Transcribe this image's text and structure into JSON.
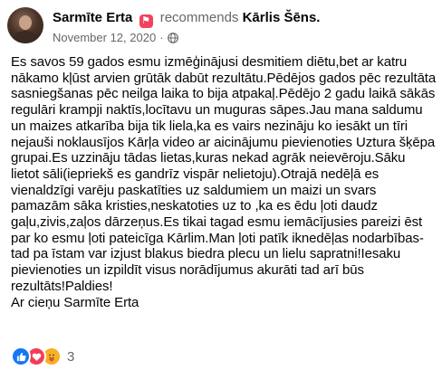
{
  "post": {
    "author": "Sarmīte Erta",
    "action": "recommends",
    "recommended_page": "Kārlis Šēns.",
    "date": "November 12, 2020",
    "separator": "·",
    "body": [
      "Es savos 59 gados esmu izmēģinājusi desmitiem diētu,bet ar katru nākamo kļūst arvien grūtāk dabūt rezultātu.Pēdējos gados pēc rezultāta sasniegšanas pēc neilga laika to bija atpakaļ.Pēdējo 2 gadu laikā sākās regulāri krampji naktīs,locītavu un muguras sāpes.Jau mana saldumu un maizes atkarība bija tik liela,ka es vairs nezināju ko iesākt un tīri nejauši noklausījos Kārļa video ar aicinājumu pievienoties Uztura šķēpa grupai.Es uzzināju tādas lietas,kuras nekad agrāk neievēroju.Sāku lietot sāli(iepriekš es gandrīz vispār nelietoju).Otrajā nedēļā es vienaldzīgi varēju paskatīties uz saldumiem un maizi un svars pamazām sāka kristies,neskatoties uz to ,ka es ēdu ļoti daudz gaļu,zivis,zaļos dārzeņus.Es tikai tagad esmu iemācījusies pareizi ēst par ko esmu ļoti pateicīga Kārlim.Man ļoti patīk iknedēļas nodarbības-tad pa īstam var izjust blakus biedra plecu un lielu sapratni!Iesaku pievienoties un izpildīt visus norādījumus akurāti tad arī būs rezultāts!Paldies!",
      "Ar cieņu Sarmīte Erta"
    ]
  },
  "reactions": {
    "types": [
      "like-icon",
      "love-icon",
      "care-icon"
    ],
    "count": "3"
  },
  "colors": {
    "recommend_badge": "#f3425f",
    "secondary_text": "#65676b",
    "like": "#1877f2",
    "love": "#f33e58",
    "care": "#f7b125"
  }
}
